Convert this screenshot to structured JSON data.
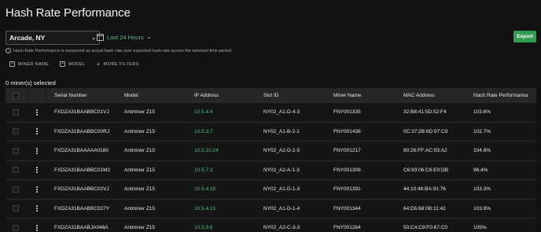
{
  "page": {
    "title": "Hash Rate Performance",
    "location": "Arcade, NY",
    "time_range": "Last 24 Hours",
    "export_label": "Export",
    "info_text": "Hash Rate Performance is measured as actual hash rate over expected hash rate across the selected time period.",
    "filters": [
      "MINER NAME",
      "MODEL",
      "MORE FILTERS"
    ],
    "selected_text": "0 miner(s) selected"
  },
  "colors": {
    "accent_green": "#4cc17a",
    "export_bg": "#2f9d52",
    "background": "#121212"
  },
  "table": {
    "columns": [
      "Serial Number",
      "Model",
      "IP Address",
      "Slot ID",
      "Miner Name",
      "MAC Address",
      "Hash Rate Performance"
    ],
    "rows": [
      {
        "serial": "FXDZA31BAABBC01VJ",
        "model": "Antminer Z15",
        "ip": "10.5.4.4",
        "slot": "NY02_A1-D-4-3",
        "miner": "FNY001335",
        "mac": "32:B8:41:5D:52:F4",
        "perf": "103.6%"
      },
      {
        "serial": "FXDZA31BAABBC00RJ",
        "model": "Antminer Z15",
        "ip": "10.5.3.7",
        "slot": "NY02_A1-B-2-1",
        "miner": "FNY001436",
        "mac": "0C:37:2B:6D:97:C9",
        "perf": "102.7%"
      },
      {
        "serial": "FXDZA31BAAAAA0180",
        "model": "Antminer Z15",
        "ip": "10.5.10.24",
        "slot": "NY02_A2-D-2-5",
        "miner": "FNY001217",
        "mac": "80:26:FF:AC:03:A2",
        "perf": "104.8%"
      },
      {
        "serial": "FXDZA31BAABBC01M2",
        "model": "Antminer Z15",
        "ip": "10.5.7.3",
        "slot": "NY02_A2-A-1-3",
        "miner": "FNY001309",
        "mac": "C6:83:06:C6:E0:DB",
        "perf": "96.4%"
      },
      {
        "serial": "FXDZA31BAABBC02VJ",
        "model": "Antminer Z15",
        "ip": "10.5.4.18",
        "slot": "NY02_A1-D-1-3",
        "miner": "FNY001391",
        "mac": "44:10:48:BA:91:76",
        "perf": "103.3%"
      },
      {
        "serial": "FXDZA31BAABBC027Y",
        "model": "Antminer Z15",
        "ip": "10.5.4.15",
        "slot": "NY02_A1-D-1-4",
        "miner": "FNY001344",
        "mac": "64:D5:68:0B:11:42",
        "perf": "103.9%"
      },
      {
        "serial": "FXDZA31BAABJA046A",
        "model": "Antminer Z15",
        "ip": "10.5.9.6",
        "slot": "NY02_A2-C-3-3",
        "miner": "FNY001264",
        "mac": "50:C4:C9:F0:67:C0",
        "perf": "105%"
      }
    ]
  }
}
